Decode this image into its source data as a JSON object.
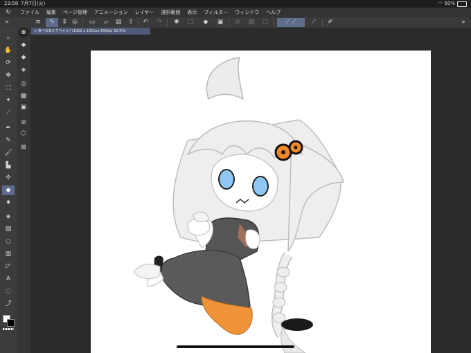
{
  "status": {
    "time": "23:58",
    "date": "7月7日(火)",
    "wifi_icon": "wifi-icon",
    "battery": "50%"
  },
  "menu": {
    "items": [
      "ファイル",
      "編集",
      "ページ管理",
      "アニメーション",
      "レイヤー",
      "選択範囲",
      "表示",
      "フィルター",
      "ウィンドウ",
      "ヘルプ"
    ]
  },
  "toolbar": {
    "icons": [
      "menu-icon",
      "pen-tool-icon",
      "updown-icon",
      "stamp-icon",
      "new-file-icon",
      "open-icon",
      "save-icon",
      "upload-icon",
      "undo-icon",
      "redo-icon",
      "transform-icon",
      "deselect-icon",
      "fill-icon",
      "crop-icon",
      "ruler-snap-icon",
      "ruler-icon",
      "frame-icon",
      "stroke-ruler-icon",
      "stroke-ruler-alt-icon",
      "pen-settings-icon",
      "edit-icon"
    ]
  },
  "tools": {
    "items": [
      "zoom-icon",
      "hand-icon",
      "rotate-icon",
      "move-icon",
      "select-rect-icon",
      "magic-wand-icon",
      "eyedropper-icon",
      "pen-icon",
      "pencil-icon",
      "brush-icon",
      "airbrush-icon",
      "decoration-icon",
      "eraser-icon",
      "blend-icon",
      "fill-icon",
      "gradient-icon",
      "figure-icon",
      "frame-border-icon",
      "ruler-icon",
      "text-icon",
      "balloon-icon",
      "correction-line-icon"
    ],
    "active_index": 12
  },
  "subtools": {
    "items": [
      "lasso-fill-icon",
      "fill-bucket-icon",
      "close-gap-fill-icon",
      "paint-unfilled-icon",
      "enclose-fill-icon",
      "fill-ref-icon",
      "fill-layer-icon",
      "reference-layer-icon",
      "layer-icon",
      "transparent-icon"
    ]
  },
  "document": {
    "tab_label": "× 食べるあかりちゃん* (1022 x 1021px 600dpi 92.9%)"
  },
  "colors": {
    "main": "#ffffff",
    "sub": "#000000",
    "accent": "#5e6b8a",
    "skirt": "#555555",
    "hair_clip": "#f0882a",
    "eyes": "#8ec8f2"
  }
}
